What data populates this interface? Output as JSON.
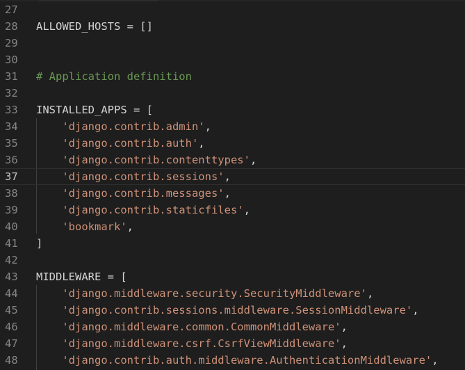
{
  "editor": {
    "current_line": 37,
    "lines": [
      {
        "num": "27",
        "tokens": []
      },
      {
        "num": "28",
        "tokens": [
          {
            "t": "plain",
            "v": "ALLOWED_HOSTS = []"
          }
        ]
      },
      {
        "num": "29",
        "tokens": []
      },
      {
        "num": "30",
        "tokens": []
      },
      {
        "num": "31",
        "tokens": [
          {
            "t": "comment",
            "v": "# Application definition"
          }
        ]
      },
      {
        "num": "32",
        "tokens": []
      },
      {
        "num": "33",
        "tokens": [
          {
            "t": "plain",
            "v": "INSTALLED_APPS = ["
          }
        ]
      },
      {
        "num": "34",
        "tokens": [
          {
            "t": "plain",
            "v": "    "
          },
          {
            "t": "string",
            "v": "'django.contrib.admin'"
          },
          {
            "t": "plain",
            "v": ","
          }
        ]
      },
      {
        "num": "35",
        "tokens": [
          {
            "t": "plain",
            "v": "    "
          },
          {
            "t": "string",
            "v": "'django.contrib.auth'"
          },
          {
            "t": "plain",
            "v": ","
          }
        ]
      },
      {
        "num": "36",
        "tokens": [
          {
            "t": "plain",
            "v": "    "
          },
          {
            "t": "string",
            "v": "'django.contrib.contenttypes'"
          },
          {
            "t": "plain",
            "v": ","
          }
        ]
      },
      {
        "num": "37",
        "tokens": [
          {
            "t": "plain",
            "v": "    "
          },
          {
            "t": "string",
            "v": "'django.contrib.sessions'"
          },
          {
            "t": "plain",
            "v": ","
          }
        ]
      },
      {
        "num": "38",
        "tokens": [
          {
            "t": "plain",
            "v": "    "
          },
          {
            "t": "string",
            "v": "'django.contrib.messages'"
          },
          {
            "t": "plain",
            "v": ","
          }
        ]
      },
      {
        "num": "39",
        "tokens": [
          {
            "t": "plain",
            "v": "    "
          },
          {
            "t": "string",
            "v": "'django.contrib.staticfiles'"
          },
          {
            "t": "plain",
            "v": ","
          }
        ]
      },
      {
        "num": "40",
        "tokens": [
          {
            "t": "plain",
            "v": "    "
          },
          {
            "t": "string",
            "v": "'bookmark'"
          },
          {
            "t": "plain",
            "v": ","
          }
        ]
      },
      {
        "num": "41",
        "tokens": [
          {
            "t": "plain",
            "v": "]"
          }
        ]
      },
      {
        "num": "42",
        "tokens": []
      },
      {
        "num": "43",
        "tokens": [
          {
            "t": "plain",
            "v": "MIDDLEWARE = ["
          }
        ]
      },
      {
        "num": "44",
        "tokens": [
          {
            "t": "plain",
            "v": "    "
          },
          {
            "t": "string",
            "v": "'django.middleware.security.SecurityMiddleware'"
          },
          {
            "t": "plain",
            "v": ","
          }
        ]
      },
      {
        "num": "45",
        "tokens": [
          {
            "t": "plain",
            "v": "    "
          },
          {
            "t": "string",
            "v": "'django.contrib.sessions.middleware.SessionMiddleware'"
          },
          {
            "t": "plain",
            "v": ","
          }
        ]
      },
      {
        "num": "46",
        "tokens": [
          {
            "t": "plain",
            "v": "    "
          },
          {
            "t": "string",
            "v": "'django.middleware.common.CommonMiddleware'"
          },
          {
            "t": "plain",
            "v": ","
          }
        ]
      },
      {
        "num": "47",
        "tokens": [
          {
            "t": "plain",
            "v": "    "
          },
          {
            "t": "string",
            "v": "'django.middleware.csrf.CsrfViewMiddleware'"
          },
          {
            "t": "plain",
            "v": ","
          }
        ]
      },
      {
        "num": "48",
        "tokens": [
          {
            "t": "plain",
            "v": "    "
          },
          {
            "t": "string",
            "v": "'django.contrib.auth.middleware.AuthenticationMiddleware'"
          },
          {
            "t": "plain",
            "v": ","
          }
        ]
      }
    ]
  },
  "colors": {
    "background": "#1e1e1e",
    "line_number": "#858585",
    "line_number_active": "#c6c6c6",
    "plain": "#d4d4d4",
    "string": "#ce9178",
    "comment": "#6a9955"
  }
}
